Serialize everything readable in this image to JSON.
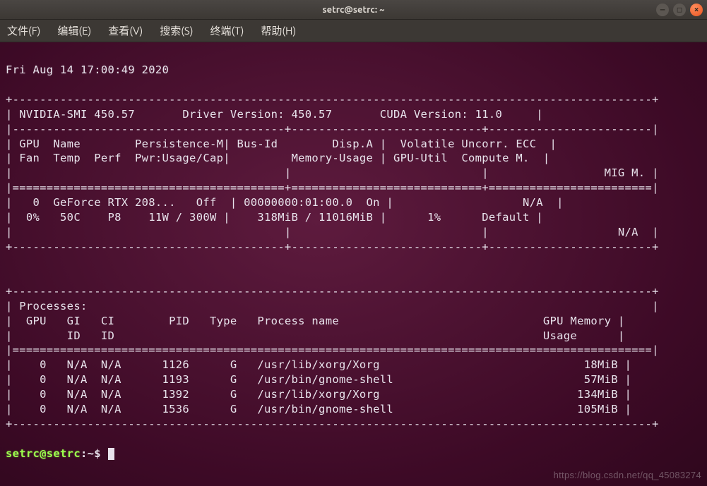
{
  "window": {
    "title": "setrc@setrc: ~",
    "minimize_tip": "minimize",
    "maximize_tip": "maximize",
    "close_tip": "close"
  },
  "menu": {
    "file": "文件(F)",
    "edit": "编辑(E)",
    "view": "查看(V)",
    "search": "搜索(S)",
    "terminal": "终端(T)",
    "help": "帮助(H)"
  },
  "nvsmi": {
    "timestamp": "Fri Aug 14 17:00:49 2020",
    "smi_version": "450.57",
    "driver_version": "450.57",
    "cuda_version": "11.0",
    "headers": {
      "gpu": "GPU",
      "name": "Name",
      "persistence": "Persistence-M",
      "fan": "Fan",
      "temp": "Temp",
      "perf": "Perf",
      "pwr": "Pwr:Usage/Cap",
      "busid": "Bus-Id",
      "dispa": "Disp.A",
      "memusage": "Memory-Usage",
      "volatile": "Volatile Uncorr. ECC",
      "gpuutil": "GPU-Util",
      "compute": "Compute M.",
      "mig": "MIG M.",
      "processes": "Processes:",
      "gi": "GI",
      "ci": "CI",
      "id": "ID",
      "pid": "PID",
      "type": "Type",
      "process_name": "Process name",
      "gpu_memory": "GPU Memory",
      "usage": "Usage"
    },
    "gpus": [
      {
        "index": "0",
        "name": "GeForce RTX 208...",
        "persistence": "Off",
        "fan": "0%",
        "temp": "50C",
        "perf": "P8",
        "pwr_usage": "11W",
        "pwr_cap": "300W",
        "bus_id": "00000000:01:00.0",
        "disp_a": "On",
        "mem_used": "318MiB",
        "mem_total": "11016MiB",
        "volatile_ecc": "N/A",
        "gpu_util": "1%",
        "compute_m": "Default",
        "mig_m": "N/A"
      }
    ],
    "processes": [
      {
        "gpu": "0",
        "gi": "N/A",
        "ci": "N/A",
        "pid": "1126",
        "type": "G",
        "name": "/usr/lib/xorg/Xorg",
        "gpu_mem": "18MiB"
      },
      {
        "gpu": "0",
        "gi": "N/A",
        "ci": "N/A",
        "pid": "1193",
        "type": "G",
        "name": "/usr/bin/gnome-shell",
        "gpu_mem": "57MiB"
      },
      {
        "gpu": "0",
        "gi": "N/A",
        "ci": "N/A",
        "pid": "1392",
        "type": "G",
        "name": "/usr/lib/xorg/Xorg",
        "gpu_mem": "134MiB"
      },
      {
        "gpu": "0",
        "gi": "N/A",
        "ci": "N/A",
        "pid": "1536",
        "type": "G",
        "name": "/usr/bin/gnome-shell",
        "gpu_mem": "105MiB"
      }
    ]
  },
  "prompt": {
    "user_host": "setrc@setrc",
    "colon": ":",
    "path": "~",
    "symbol": "$"
  },
  "watermark": "https://blog.csdn.net/qq_45083274"
}
